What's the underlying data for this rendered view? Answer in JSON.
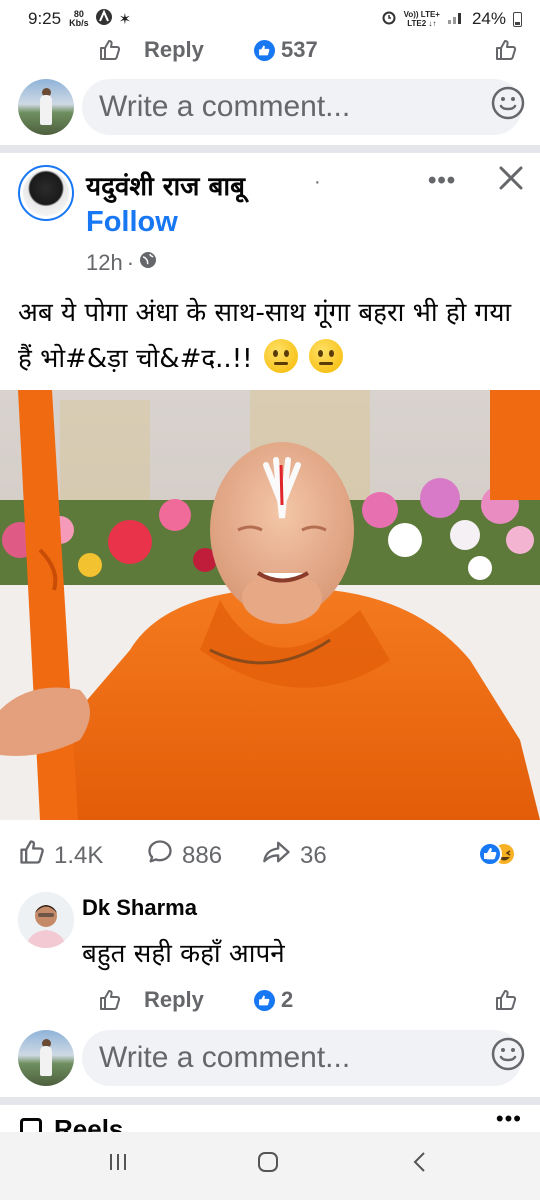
{
  "status_bar": {
    "time": "9:25",
    "data_rate_value": "80",
    "data_rate_unit": "Kb/s",
    "network_top": "Vo)) LTE+",
    "network_bottom": "LTE2 ↓↑",
    "battery_percent": "24%"
  },
  "top_comment_actions": {
    "reply_label": "Reply",
    "reaction_count": "537"
  },
  "composer": {
    "placeholder": "Write a comment..."
  },
  "post": {
    "author": "यदुवंशी राज बाबू",
    "follow_label": "Follow",
    "time": "12h",
    "text": "अब ये पोगा अंधा के साथ-साथ  गूंगा बहरा भी हो गया हैं भो#&ड़ा चो&#द..!!",
    "stats": {
      "likes": "1.4K",
      "comments": "886",
      "shares": "36"
    }
  },
  "comment": {
    "author": "Dk Sharma",
    "text": "बहुत सही कहाँ आपने",
    "reply_label": "Reply",
    "reaction_count": "2"
  },
  "bottom_composer": {
    "placeholder": "Write a comment..."
  },
  "next_section": {
    "title": "Reels"
  },
  "colors": {
    "brand_blue": "#1877f2",
    "secondary_text": "#65676b",
    "input_bg": "#f0f2f5",
    "robe_orange": "#f06a12"
  }
}
